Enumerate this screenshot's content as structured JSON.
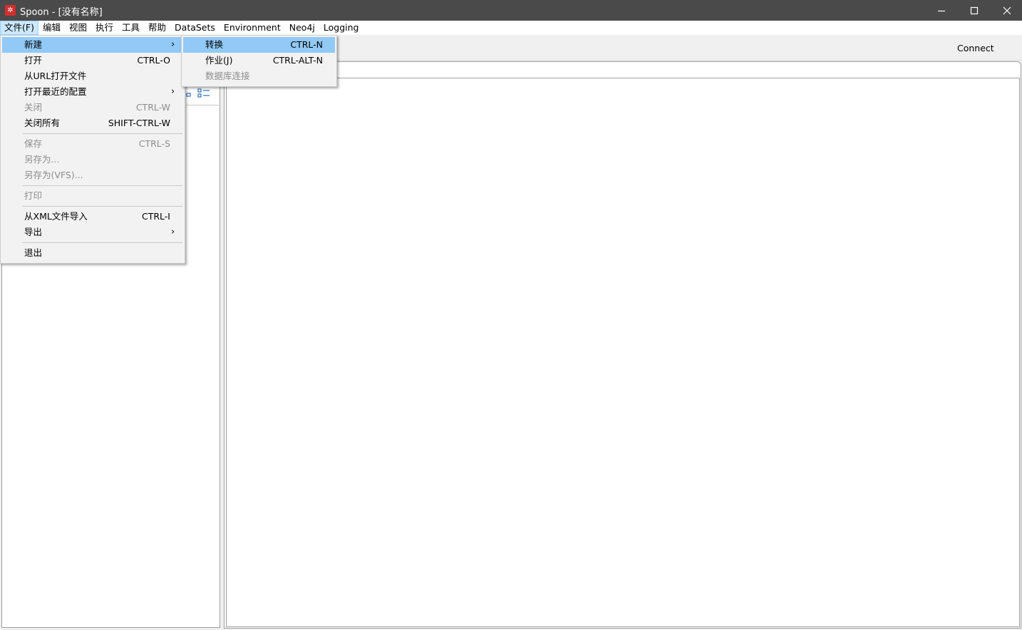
{
  "window": {
    "title": "Spoon - [没有名称]",
    "logo_glyph": "✲",
    "minimize_icon": "minimize-icon",
    "maximize_icon": "maximize-icon",
    "close_icon": "close-icon"
  },
  "menubar": {
    "items": [
      "文件(F)",
      "编辑",
      "视图",
      "执行",
      "工具",
      "帮助",
      "DataSets",
      "Environment",
      "Neo4j",
      "Logging"
    ]
  },
  "toolbar": {
    "connect_label": "Connect"
  },
  "file_menu": {
    "items": [
      {
        "label": "新建",
        "shortcut": "",
        "submenu": true,
        "enabled": true,
        "highlighted": true
      },
      {
        "label": "打开",
        "shortcut": "CTRL-O",
        "enabled": true
      },
      {
        "label": "从URL打开文件",
        "shortcut": "",
        "enabled": true
      },
      {
        "label": "打开最近的配置",
        "shortcut": "",
        "submenu": true,
        "enabled": true
      },
      {
        "label": "关闭",
        "shortcut": "CTRL-W",
        "enabled": false
      },
      {
        "label": "关闭所有",
        "shortcut": "SHIFT-CTRL-W",
        "enabled": true
      },
      {
        "label": "保存",
        "shortcut": "CTRL-S",
        "enabled": false
      },
      {
        "label": "另存为...",
        "shortcut": "",
        "enabled": false
      },
      {
        "label": "另存为(VFS)...",
        "shortcut": "",
        "enabled": false
      },
      {
        "label": "打印",
        "shortcut": "",
        "enabled": false
      },
      {
        "label": "从XML文件导入",
        "shortcut": "CTRL-I",
        "enabled": true
      },
      {
        "label": "导出",
        "shortcut": "",
        "submenu": true,
        "enabled": true
      },
      {
        "label": "退出",
        "shortcut": "",
        "enabled": true
      }
    ],
    "arrow_glyph": "›"
  },
  "new_submenu": {
    "items": [
      {
        "label": "转换",
        "shortcut": "CTRL-N",
        "enabled": true,
        "highlighted": true
      },
      {
        "label": "作业(J)",
        "shortcut": "CTRL-ALT-N",
        "enabled": true
      },
      {
        "label": "数据库连接",
        "shortcut": "",
        "enabled": false
      }
    ]
  },
  "colors": {
    "titlebar": "#4b4a4a",
    "menu_highlight": "#91c9f7",
    "menubar_active": "#cce8ff",
    "disabled_text": "#8c8c8c"
  }
}
